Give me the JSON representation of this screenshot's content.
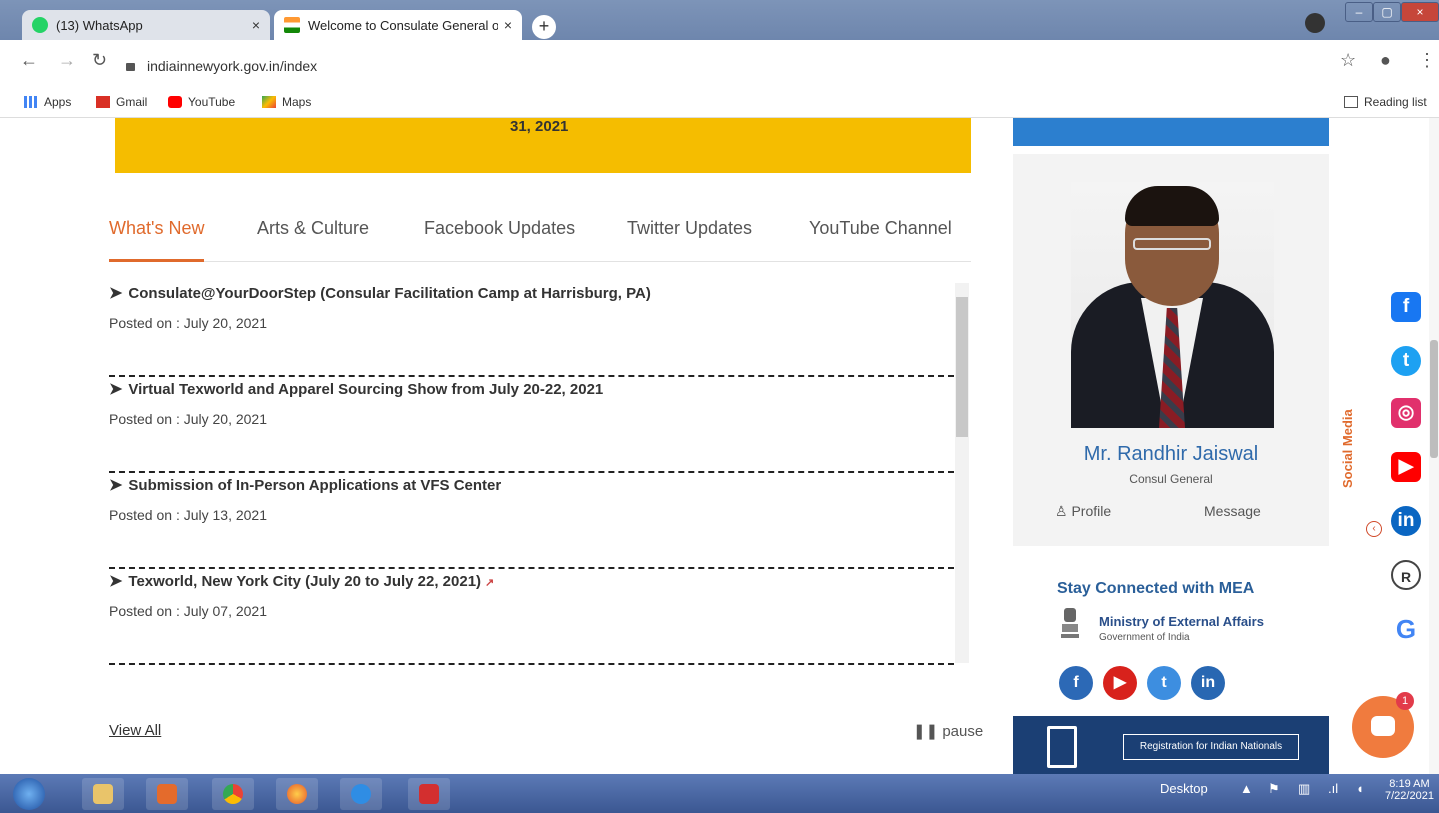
{
  "browser": {
    "tabs": [
      {
        "title": "(13) WhatsApp",
        "close": "×"
      },
      {
        "title": "Welcome to Consulate General o",
        "close": "×"
      }
    ],
    "new_tab": "+",
    "url": "indiainnewyork.gov.in/index",
    "bookmarks": [
      "Apps",
      "Gmail",
      "YouTube",
      "Maps"
    ],
    "reading_list": "Reading list",
    "window_controls": [
      "–",
      "▢",
      "×"
    ]
  },
  "banner": {
    "text": "31, 2021"
  },
  "tabs": [
    "What's New",
    "Arts & Culture",
    "Facebook Updates",
    "Twitter Updates",
    "YouTube Channel"
  ],
  "news": [
    {
      "title": "Consulate@YourDoorStep (Consular Facilitation Camp at Harrisburg, PA)",
      "posted": "Posted on : July 20, 2021"
    },
    {
      "title": "Virtual Texworld and Apparel Sourcing Show from July 20-22, 2021",
      "posted": "Posted on : July 20, 2021"
    },
    {
      "title": "Submission of In-Person Applications at VFS Center",
      "posted": "Posted on : July 13, 2021"
    },
    {
      "title": "Texworld, New York City (July 20 to July 22, 2021)",
      "posted": "Posted on : July 07, 2021"
    }
  ],
  "view_all": "View All",
  "pause": "pause",
  "consul": {
    "name": "Mr. Randhir Jaiswal",
    "title": "Consul General",
    "profile": "Profile",
    "message": "Message"
  },
  "mea": {
    "title": "Stay Connected with MEA",
    "ministry": "Ministry of External Affairs",
    "government": "Government of India"
  },
  "registration": "Registration for Indian Nationals",
  "social_media_label": "Social Media",
  "chat_badge": "1",
  "taskbar": {
    "desktop": "Desktop",
    "time": "8:19 AM",
    "date": "7/22/2021"
  }
}
